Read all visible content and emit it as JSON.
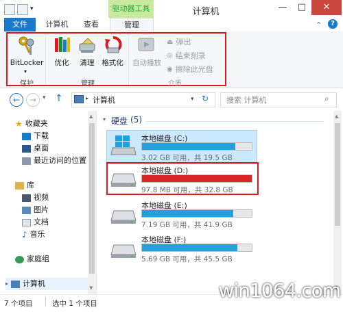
{
  "window": {
    "title": "计算机",
    "context_tab": "驱动器工具",
    "controls": [
      "—",
      "□",
      "✕"
    ]
  },
  "ribbon_tabs": [
    "文件",
    "计算机",
    "查看",
    "管理"
  ],
  "ribbon": {
    "groups": [
      {
        "label": "保护",
        "buttons": [
          {
            "label": "BitLocker",
            "icon": "keys-icon"
          }
        ]
      },
      {
        "label": "管理",
        "buttons": [
          {
            "label": "优化",
            "icon": "optimize-icon"
          },
          {
            "label": "清理",
            "icon": "cleanup-icon"
          },
          {
            "label": "格式化",
            "icon": "format-icon"
          }
        ]
      },
      {
        "label": "介质",
        "buttons": [
          {
            "label": "自动播放",
            "icon": "autoplay-icon"
          },
          {
            "label": "弹出",
            "icon": "eject-icon"
          },
          {
            "label": "结束刻录",
            "icon": "finish-burn-icon"
          },
          {
            "label": "擦除此光盘",
            "icon": "erase-disc-icon"
          }
        ]
      }
    ]
  },
  "address": {
    "path": "计算机",
    "search_placeholder": "搜索 计算机"
  },
  "nav_pane": {
    "favorites": {
      "label": "收藏夹",
      "items": [
        "下载",
        "桌面",
        "最近访问的位置"
      ]
    },
    "libraries": {
      "label": "库",
      "items": [
        "视频",
        "图片",
        "文档",
        "音乐"
      ]
    },
    "homegroup": "家庭组",
    "computer": "计算机"
  },
  "section": {
    "label": "硬盘",
    "count": "(5)"
  },
  "drives": [
    {
      "name": "本地磁盘 (C:)",
      "info": "3.02 GB 可用，共 19.5 GB",
      "used_fraction": 0.85,
      "selected": true,
      "critical": false
    },
    {
      "name": "本地磁盘 (D:)",
      "info": "97.8 MB 可用，共 32.8 GB",
      "used_fraction": 0.997,
      "selected": false,
      "critical": true
    },
    {
      "name": "本地磁盘 (E:)",
      "info": "7.19 GB 可用，共 41.9 GB",
      "used_fraction": 0.83,
      "selected": false,
      "critical": false
    },
    {
      "name": "本地磁盘 (F:)",
      "info": "5.69 GB 可用，共 45.5 GB",
      "used_fraction": 0.87,
      "selected": false,
      "critical": false
    }
  ],
  "status": {
    "count": "7 个项目",
    "selected": "选中 1 个项目"
  },
  "watermark": "win1064.com"
}
